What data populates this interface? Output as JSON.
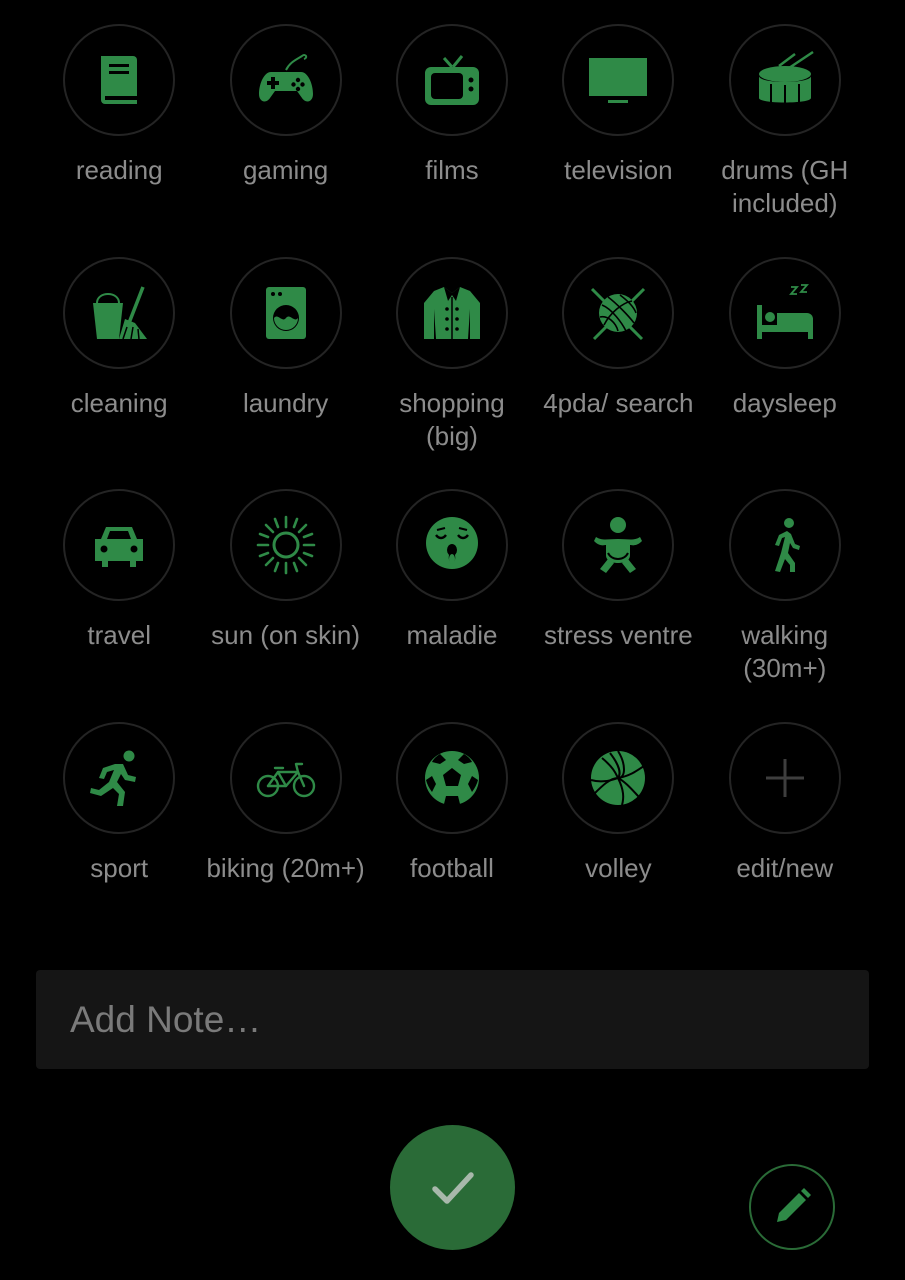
{
  "accent_color": "#2f8a47",
  "activities": [
    {
      "label": "reading",
      "icon": "book-icon"
    },
    {
      "label": "gaming",
      "icon": "gamepad-icon"
    },
    {
      "label": "films",
      "icon": "tv-icon"
    },
    {
      "label": "television",
      "icon": "monitor-icon"
    },
    {
      "label": "drums (GH included)",
      "icon": "drum-icon"
    },
    {
      "label": "cleaning",
      "icon": "bucket-broom-icon"
    },
    {
      "label": "laundry",
      "icon": "washing-machine-icon"
    },
    {
      "label": "shopping (big)",
      "icon": "coat-icon"
    },
    {
      "label": "4pda/ search",
      "icon": "yarn-ball-icon"
    },
    {
      "label": "daysleep",
      "icon": "bed-sleep-icon"
    },
    {
      "label": "travel",
      "icon": "car-icon"
    },
    {
      "label": "sun (on skin)",
      "icon": "sun-icon"
    },
    {
      "label": "maladie",
      "icon": "sick-face-icon"
    },
    {
      "label": "stress ventre",
      "icon": "baby-icon"
    },
    {
      "label": "walking (30m+)",
      "icon": "walking-icon"
    },
    {
      "label": "sport",
      "icon": "running-icon"
    },
    {
      "label": "biking (20m+)",
      "icon": "bicycle-icon"
    },
    {
      "label": "football",
      "icon": "soccer-ball-icon"
    },
    {
      "label": "volley",
      "icon": "volleyball-icon"
    },
    {
      "label": "edit/new",
      "icon": "plus-icon"
    }
  ],
  "note": {
    "placeholder": "Add Note…",
    "value": ""
  },
  "actions": {
    "confirm_icon": "check-icon",
    "edit_icon": "pencil-icon"
  }
}
